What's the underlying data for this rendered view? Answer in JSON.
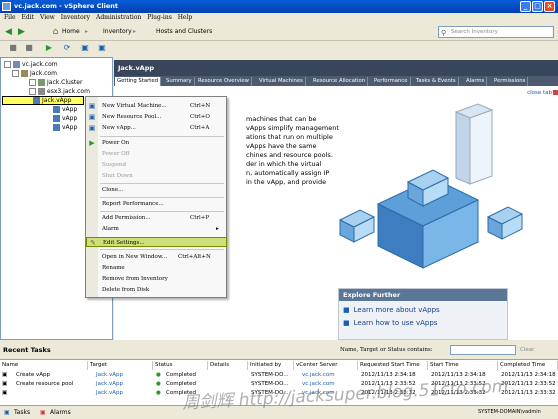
{
  "window": {
    "title": "vc.jack.com - vSphere Client"
  },
  "menubar": [
    "File",
    "Edit",
    "View",
    "Inventory",
    "Administration",
    "Plug-ins",
    "Help"
  ],
  "nav": {
    "home": "Home",
    "inventory": "Inventory",
    "hosts": "Hosts and Clusters",
    "search_placeholder": "Search Inventory"
  },
  "tree": {
    "root": "vc.jack.com",
    "datacenter": "Jack.com",
    "cluster": "Jack.Cluster",
    "host": "esx3.jack.com",
    "vapp_selected": "Jack.vApp",
    "child1": "vApp",
    "child2": "vApp",
    "child3": "vApp"
  },
  "panel": {
    "title": "Jack.vApp",
    "close_tab": "close tab",
    "tabs": [
      "Getting Started",
      "Summary",
      "Resource Overview",
      "Virtual Machines",
      "Resource Allocation",
      "Performance",
      "Tasks & Events",
      "Alarms",
      "Permissions"
    ]
  },
  "content_lines": [
    "machines that can be",
    "vApps simplify management",
    "ations that run on multiple",
    "vApps have the same",
    "chines and resource pools.",
    "der in which the virtual",
    "n, automatically assign IP",
    "in the vApp, and provide"
  ],
  "explore": {
    "heading": "Explore Further",
    "link1": "Learn more about vApps",
    "link2": "Learn how to use vApps"
  },
  "context_menu": {
    "items": [
      {
        "label": "New Virtual Machine...",
        "shortcut": "Ctrl+N"
      },
      {
        "label": "New Resource Pool...",
        "shortcut": "Ctrl+O"
      },
      {
        "label": "New vApp...",
        "shortcut": "Ctrl+A"
      },
      {
        "label": "Power On",
        "shortcut": ""
      },
      {
        "label": "Power Off",
        "shortcut": ""
      },
      {
        "label": "Suspend",
        "shortcut": ""
      },
      {
        "label": "Shut Down",
        "shortcut": ""
      },
      {
        "label": "Clone...",
        "shortcut": ""
      },
      {
        "label": "Report Performance...",
        "shortcut": ""
      },
      {
        "label": "Add Permission...",
        "shortcut": "Ctrl+P"
      },
      {
        "label": "Alarm",
        "shortcut": ""
      },
      {
        "label": "Edit Settings...",
        "shortcut": ""
      },
      {
        "label": "Open in New Window...",
        "shortcut": "Ctrl+Alt+N"
      },
      {
        "label": "Rename",
        "shortcut": ""
      },
      {
        "label": "Remove from Inventory",
        "shortcut": ""
      },
      {
        "label": "Delete from Disk",
        "shortcut": ""
      }
    ]
  },
  "recent_tasks": {
    "title": "Recent Tasks",
    "filter_label": "Name, Target or Status contains:",
    "clear": "Clear",
    "columns": [
      "Name",
      "Target",
      "Status",
      "Details",
      "Initiated by",
      "vCenter Server",
      "Requested Start Time",
      "Start Time",
      "Completed Time"
    ],
    "rows": [
      [
        "Create vApp",
        "Jack.vApp",
        "Completed",
        "",
        "SYSTEM-DO...",
        "vc.jack.com",
        "2012/11/13 2:34:18",
        "2012/11/13 2:34:18",
        "2012/11/13 2:34:18"
      ],
      [
        "Create resource pool",
        "Jack.vApp",
        "Completed",
        "",
        "SYSTEM-DO...",
        "vc.jack.com",
        "2012/11/13 2:33:52",
        "2012/11/13 2:33:52",
        "2012/11/13 2:33:52"
      ],
      [
        "",
        "Jack.vApp",
        "Completed",
        "",
        "SYSTEM-DO...",
        "vc.jack.com",
        "2012/11/13 2:33:32",
        "2012/11/13 2:33:32",
        "2012/11/13 2:33:32"
      ]
    ]
  },
  "status": {
    "tasks": "Tasks",
    "alarms": "Alarms",
    "user": "SYSTEM-DOMAIN\\vadmin"
  },
  "watermark": "周剑辉 http://jacksuper.blog.51cto.com"
}
